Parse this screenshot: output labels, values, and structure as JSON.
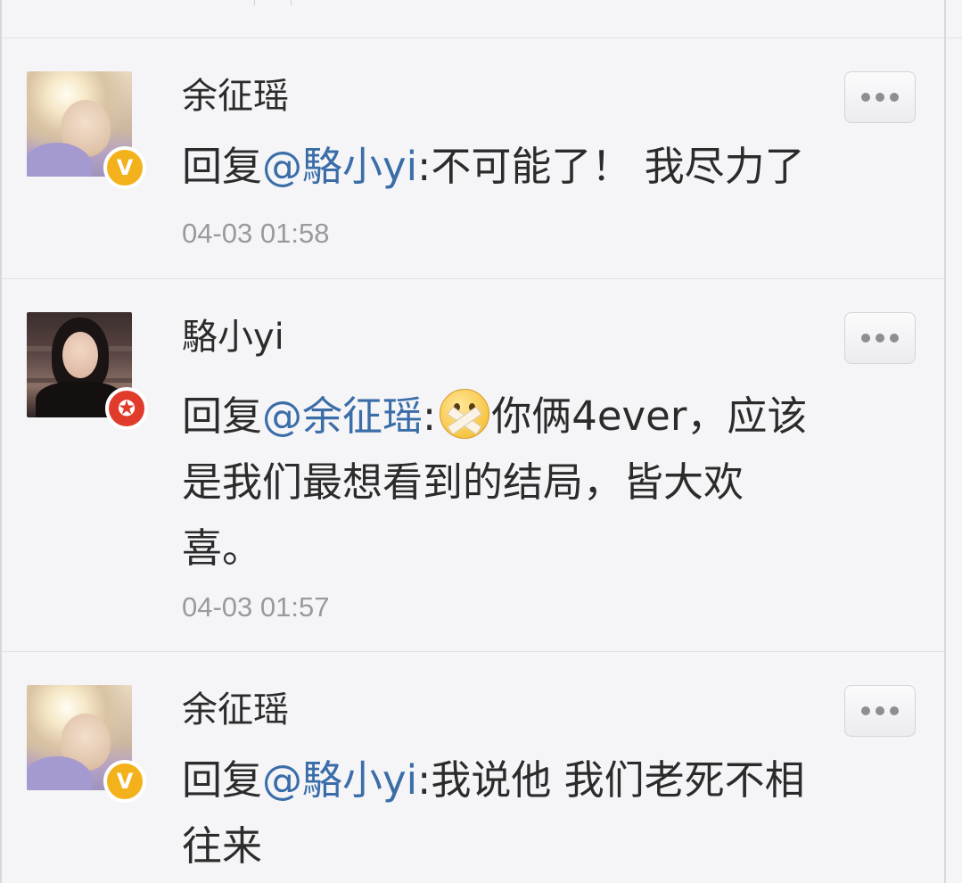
{
  "comments": [
    {
      "username": "余征瑶",
      "reply_prefix": "回复",
      "mention": "@駱小yi",
      "text_line1": ":不可能了！ 我尽力了",
      "timestamp": "04-03 01:58",
      "badge": "V",
      "avatar_style": "light"
    },
    {
      "username": "駱小yi",
      "reply_prefix": "回复",
      "mention": "@余征瑶",
      "text_line1_a": ":",
      "emoji": "zipped-mouth-emoji",
      "text_line1_b": "你俩4ever，应该",
      "text_line2": "是我们最想看到的结局，皆大欢",
      "text_line3": "喜。",
      "timestamp": "04-03 01:57",
      "badge": "✪",
      "avatar_style": "dark"
    },
    {
      "username": "余征瑶",
      "reply_prefix": "回复",
      "mention": "@駱小yi",
      "text_line1": ":我说他 我们老死不相",
      "text_line2": "往来",
      "badge": "V",
      "avatar_style": "light"
    }
  ],
  "colors": {
    "mention": "#3b6da8",
    "text": "#2b2b2b",
    "timestamp": "#9a9a9e",
    "badge_v": "#f3b11c",
    "badge_star": "#e13b2c"
  },
  "icons": {
    "more": "more-dots-icon",
    "verified": "verified-v-icon",
    "star": "star-badge-icon"
  }
}
